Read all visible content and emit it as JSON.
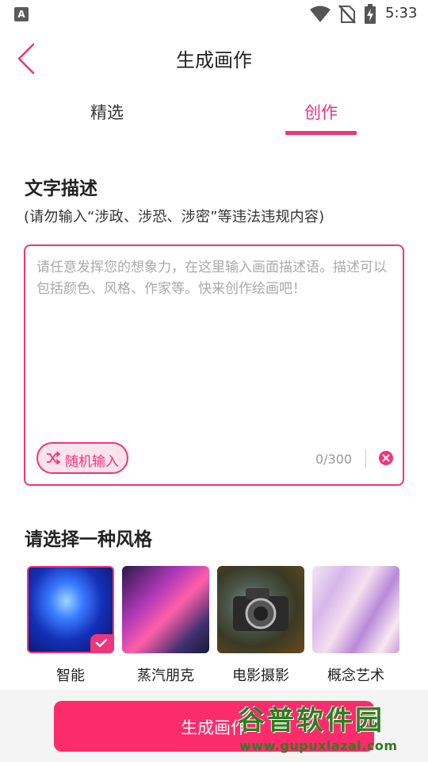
{
  "status_bar": {
    "notification_icon": "a-icon",
    "time": "5:33"
  },
  "header": {
    "title": "生成画作"
  },
  "tabs": [
    {
      "label": "精选",
      "active": false
    },
    {
      "label": "创作",
      "active": true
    }
  ],
  "description": {
    "title": "文字描述",
    "note": "(请勿输入“涉政、涉恐、涉密”等违法违规内容)",
    "input_value": "",
    "placeholder": "请任意发挥您的想象力，在这里输入画面描述语。描述可以包括颜色、风格、作家等。快来创作绘画吧！",
    "random_label": "随机输入",
    "counter": "0/300"
  },
  "styles": {
    "title": "请选择一种风格",
    "items": [
      {
        "label": "智能",
        "selected": true
      },
      {
        "label": "蒸汽朋克",
        "selected": false
      },
      {
        "label": "电影摄影",
        "selected": false
      },
      {
        "label": "概念艺术",
        "selected": false
      }
    ]
  },
  "generate_button": {
    "label": "生成画作"
  },
  "watermark": {
    "brand": "谷普软件园",
    "url": "www.gupuxlazal.com"
  },
  "colors": {
    "accent": "#f0357a",
    "button": "#fc2b6c",
    "watermark": "#2e7d1f"
  }
}
